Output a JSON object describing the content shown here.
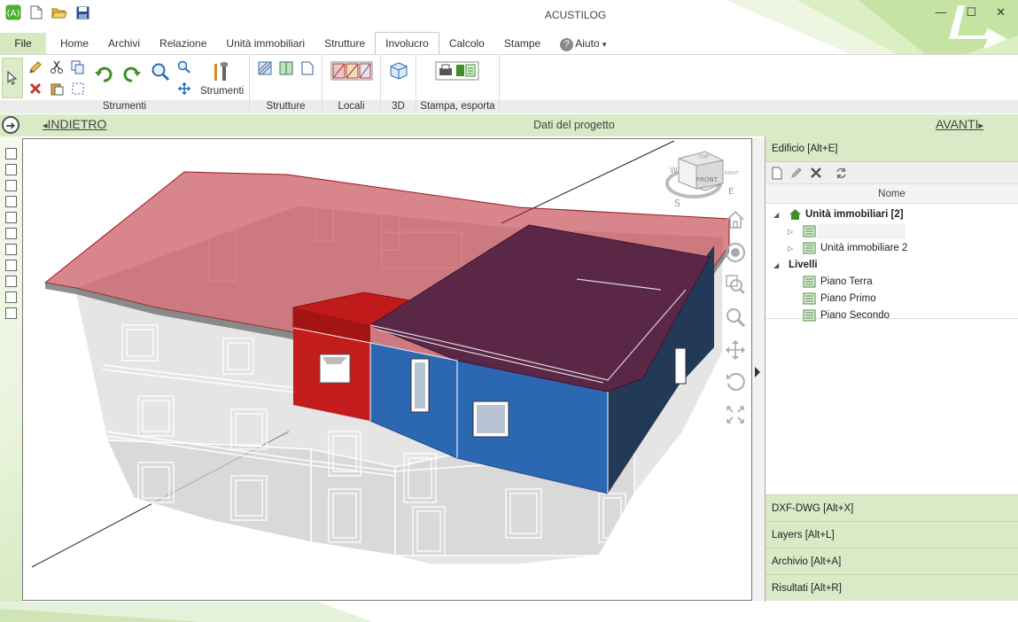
{
  "app": {
    "title": "ACUSTILOG"
  },
  "window_controls": {
    "minimize": "—",
    "maximize": "☐",
    "close": "✕"
  },
  "ribbon": {
    "tabs": [
      {
        "label": "File"
      },
      {
        "label": "Home"
      },
      {
        "label": "Archivi"
      },
      {
        "label": "Relazione"
      },
      {
        "label": "Unità immobiliari"
      },
      {
        "label": "Strutture"
      },
      {
        "label": "Involucro",
        "active": true
      },
      {
        "label": "Calcolo"
      },
      {
        "label": "Stampe"
      },
      {
        "label": "Aiuto",
        "caret": "▾",
        "help_glyph": "?"
      }
    ],
    "groups": {
      "strumenti": {
        "label": "Strumenti",
        "big_button_label": "Strumenti"
      },
      "strutture": {
        "label": "Strutture"
      },
      "locali": {
        "label": "Locali"
      },
      "view3d": {
        "label": "3D"
      },
      "stampa": {
        "label": "Stampa, esporta"
      }
    }
  },
  "navbar": {
    "back_label": "INDIETRO",
    "title": "Dati del progetto",
    "forward_label": "AVANTI",
    "back_arrow": "◂",
    "forward_arrow": "▸",
    "circle_glyph": "➔"
  },
  "left_checkboxes_count": 11,
  "view_cube": {
    "face_front": "FRONT",
    "face_top": "TOP",
    "face_left": "RIGHT",
    "compass_s": "S",
    "compass_e": "E",
    "compass_w": "W"
  },
  "right_panel": {
    "header": "Edificio [Alt+E]",
    "column_header": "Nome",
    "tree": {
      "root": {
        "label": "Unità immobiliari [2]",
        "expand": "◢"
      },
      "unit_1": {
        "label": "",
        "expand": "▷"
      },
      "unit_2": {
        "label": "Unità immobiliare 2",
        "expand": "▷"
      },
      "levels": {
        "label": "Livelli",
        "expand": "◢"
      },
      "level_items": [
        "Piano Terra",
        "Piano Primo",
        "Piano Secondo"
      ]
    },
    "footers": [
      "DXF-DWG [Alt+X]",
      "Layers [Alt+L]",
      "Archivio [Alt+A]",
      "Risultati [Alt+R]"
    ]
  },
  "colors": {
    "accent_green": "#d9eac6",
    "roof_red": "#c0444b",
    "unit1_red": "#c01e1e",
    "unit2_blue": "#2c68b2",
    "unit2_roof": "#5a2747"
  }
}
